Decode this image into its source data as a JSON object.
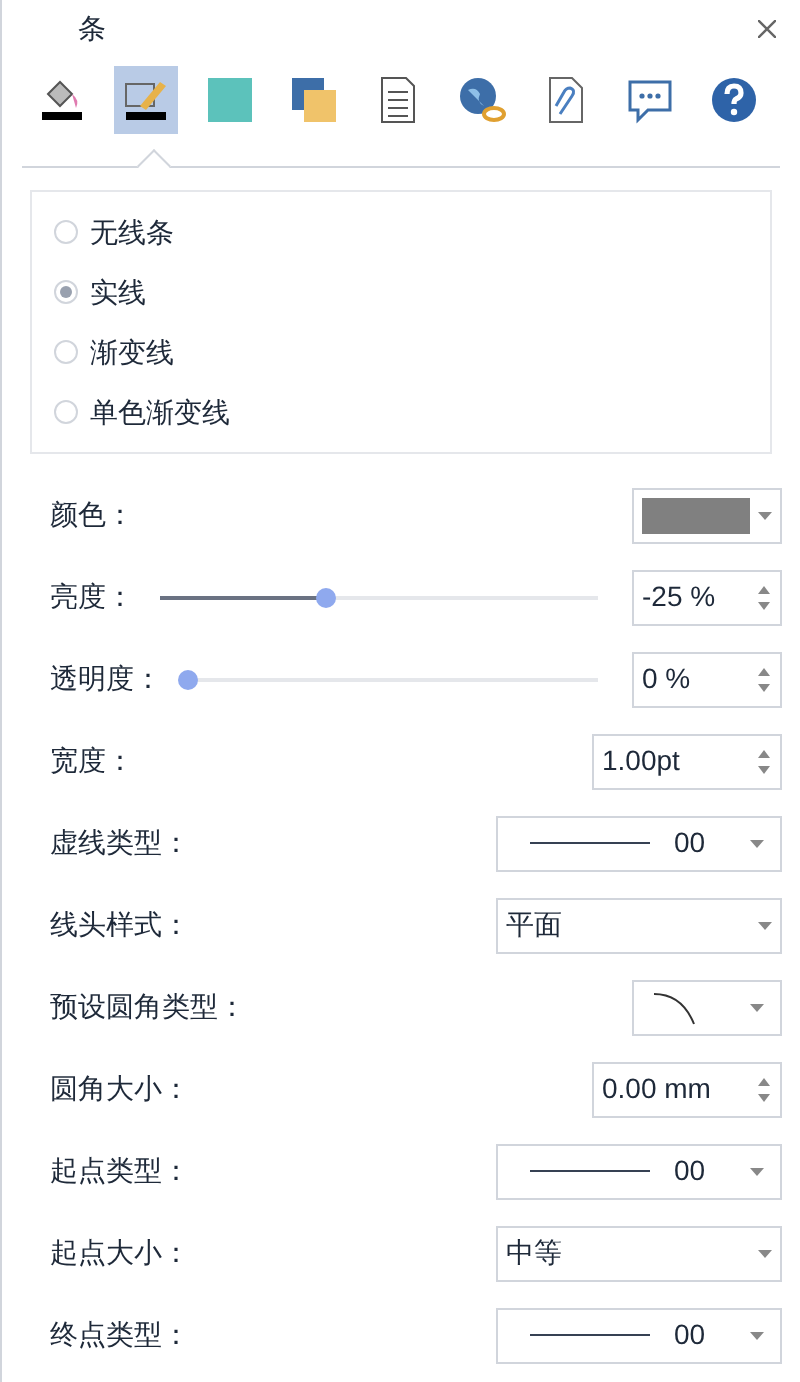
{
  "title": "条",
  "toolbar": [
    {
      "selected": false
    },
    {
      "selected": true
    },
    {
      "selected": false
    },
    {
      "selected": false
    },
    {
      "selected": false
    },
    {
      "selected": false
    },
    {
      "selected": false
    },
    {
      "selected": false
    },
    {
      "selected": false
    }
  ],
  "line_types": [
    {
      "label": "无线条",
      "selected": false
    },
    {
      "label": "实线",
      "selected": true
    },
    {
      "label": "渐变线",
      "selected": false
    },
    {
      "label": "单色渐变线",
      "selected": false
    }
  ],
  "properties": [
    {
      "kind": "color",
      "label": "颜色：",
      "color": "#808080"
    },
    {
      "kind": "slider",
      "label": "亮度：",
      "level": 0.38,
      "value": "-25 %"
    },
    {
      "kind": "slider",
      "label": "透明度：",
      "level": 0,
      "value": "0 %"
    },
    {
      "kind": "spinner",
      "label": "宽度：",
      "value": "1.00pt"
    },
    {
      "kind": "line",
      "label": "虚线类型：",
      "value": "00"
    },
    {
      "kind": "select",
      "label": "线头样式：",
      "value": "平面"
    },
    {
      "kind": "corner",
      "label": "预设圆角类型："
    },
    {
      "kind": "spinner",
      "label": "圆角大小：",
      "value": "0.00 mm"
    },
    {
      "kind": "line",
      "label": "起点类型：",
      "value": "00"
    },
    {
      "kind": "select",
      "label": "起点大小：",
      "value": "中等"
    },
    {
      "kind": "line",
      "label": "终点类型：",
      "value": "00"
    }
  ]
}
